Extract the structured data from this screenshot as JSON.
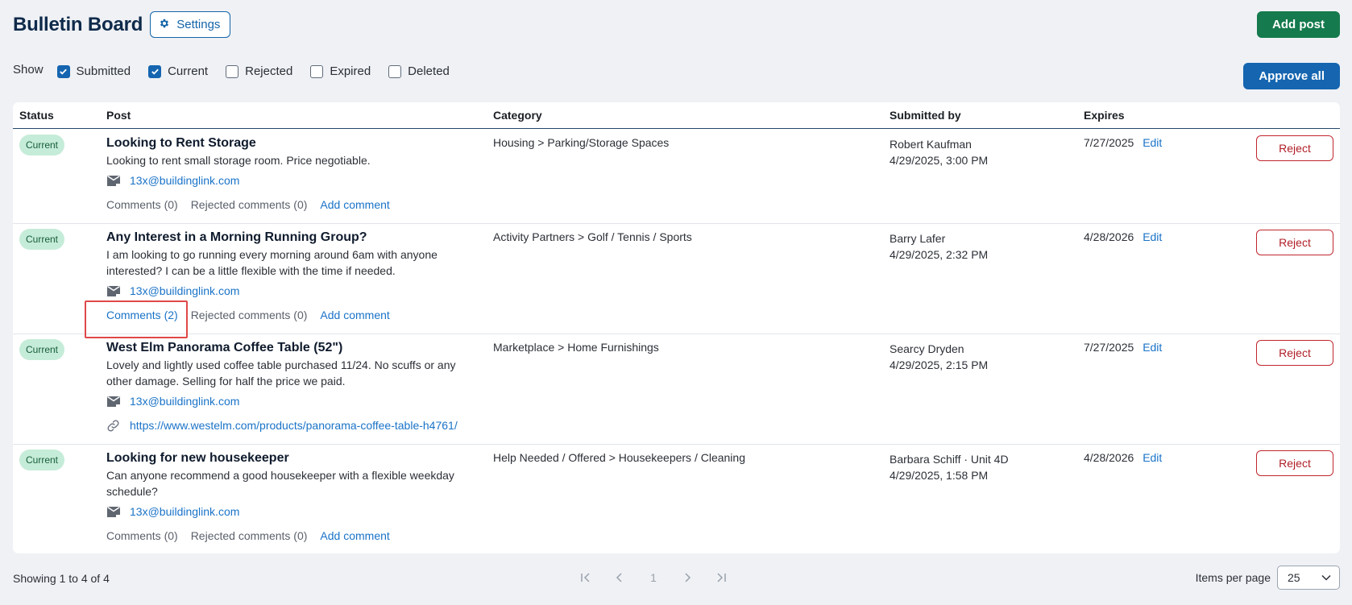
{
  "header": {
    "title": "Bulletin Board",
    "settings_label": "Settings"
  },
  "actions": {
    "add_post": "Add post",
    "approve_all": "Approve all"
  },
  "filters": {
    "label": "Show",
    "items": [
      {
        "label": "Submitted",
        "checked": true
      },
      {
        "label": "Current",
        "checked": true
      },
      {
        "label": "Rejected",
        "checked": false
      },
      {
        "label": "Expired",
        "checked": false
      },
      {
        "label": "Deleted",
        "checked": false
      }
    ]
  },
  "table": {
    "columns": [
      "Status",
      "Post",
      "Category",
      "Submitted by",
      "Expires"
    ],
    "rows": [
      {
        "status": "Current",
        "title": "Looking to Rent Storage",
        "body": "Looking to rent small storage room. Price negotiable.",
        "email": "13x@buildinglink.com",
        "comments": "Comments (0)",
        "rejected_comments": "Rejected comments (0)",
        "add_comment": "Add comment",
        "category": "Housing > Parking/Storage Spaces",
        "submitted_by": "Robert Kaufman",
        "submitted_at": "4/29/2025, 3:00 PM",
        "expires": "7/27/2025",
        "edit": "Edit",
        "reject": "Reject"
      },
      {
        "status": "Current",
        "title": "Any Interest in a Morning Running Group?",
        "body": "I am looking to go running every morning around 6am with anyone interested? I can be a little flexible with the time if needed.",
        "email": "13x@buildinglink.com",
        "comments": "Comments (2)",
        "rejected_comments": "Rejected comments (0)",
        "add_comment": "Add comment",
        "category": "Activity Partners > Golf / Tennis / Sports",
        "submitted_by": "Barry Lafer",
        "submitted_at": "4/29/2025, 2:32 PM",
        "expires": "4/28/2026",
        "edit": "Edit",
        "reject": "Reject"
      },
      {
        "status": "Current",
        "title": "West Elm Panorama Coffee Table (52\")",
        "body": "Lovely and lightly used coffee table purchased 11/24. No scuffs or any other damage. Selling for half the price we paid.",
        "email": "13x@buildinglink.com",
        "url": "https://www.westelm.com/products/panorama-coffee-table-h4761/",
        "category": "Marketplace > Home Furnishings",
        "submitted_by": "Searcy Dryden",
        "submitted_at": "4/29/2025, 2:15 PM",
        "expires": "7/27/2025",
        "edit": "Edit",
        "reject": "Reject"
      },
      {
        "status": "Current",
        "title": "Looking for new housekeeper",
        "body": "Can anyone recommend a good housekeeper with a flexible weekday schedule?",
        "email": "13x@buildinglink.com",
        "comments": "Comments (0)",
        "rejected_comments": "Rejected comments (0)",
        "add_comment": "Add comment",
        "category": "Help Needed / Offered > Housekeepers / Cleaning",
        "submitted_by": "Barbara Schiff · Unit 4D",
        "submitted_at": "4/29/2025, 1:58 PM",
        "expires": "4/28/2026",
        "edit": "Edit",
        "reject": "Reject"
      }
    ]
  },
  "footer": {
    "showing": "Showing 1 to 4 of 4",
    "current_page": "1",
    "items_per_page_label": "Items per page",
    "items_per_page_value": "25"
  },
  "colors": {
    "primary": "#1565b0",
    "success": "#157a4d",
    "danger": "#c0262d",
    "badge_bg": "#c5ecd8",
    "title": "#0e2a4a"
  },
  "icons": [
    "gear-icon",
    "checkmark-icon",
    "mail-icon",
    "link-icon",
    "first-page-icon",
    "prev-page-icon",
    "next-page-icon",
    "last-page-icon",
    "chevron-down-icon"
  ]
}
